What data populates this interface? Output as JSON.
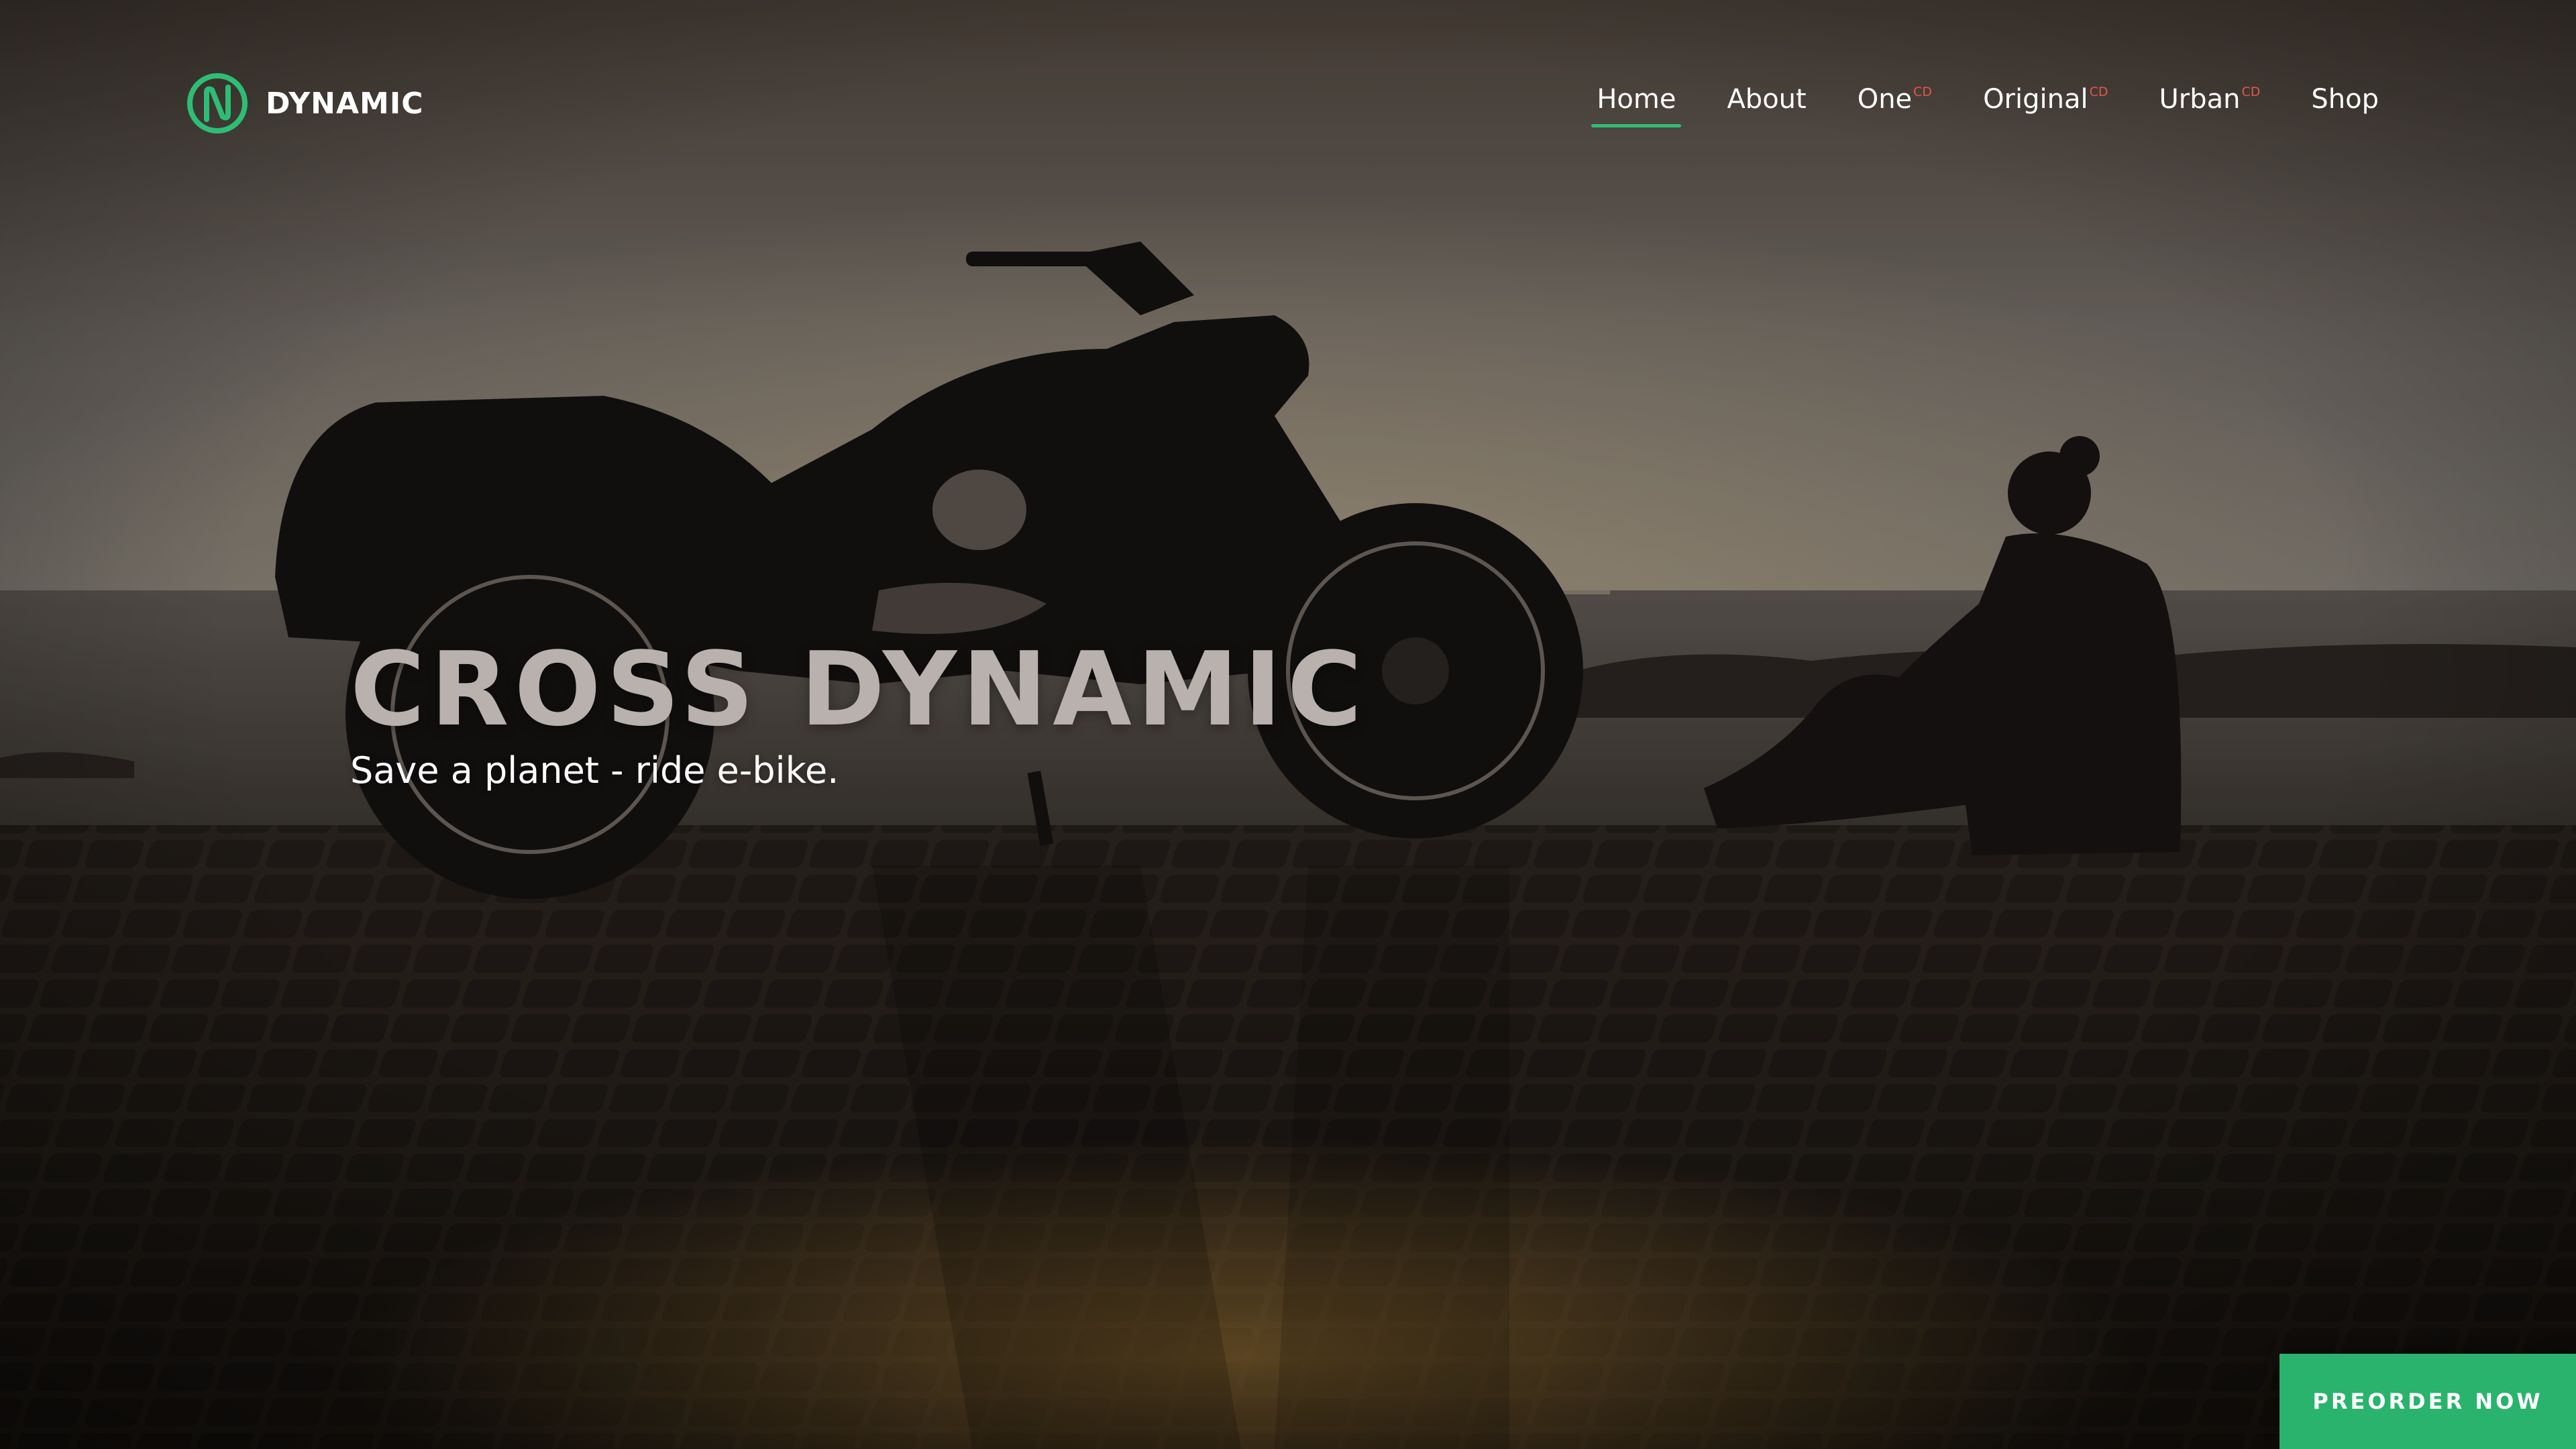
{
  "brand": {
    "name": "DYNAMIC",
    "logo_icon": "dynamic-logo-icon",
    "accent": "#2ebd74"
  },
  "nav": {
    "items": [
      {
        "label": "Home",
        "active": true,
        "badge": ""
      },
      {
        "label": "About",
        "active": false,
        "badge": ""
      },
      {
        "label": "One",
        "active": false,
        "badge": "CD"
      },
      {
        "label": "Original",
        "active": false,
        "badge": "CD"
      },
      {
        "label": "Urban",
        "active": false,
        "badge": "CD"
      },
      {
        "label": "Shop",
        "active": false,
        "badge": ""
      }
    ]
  },
  "hero": {
    "title": "CROSS DYNAMIC",
    "subtitle": "Save a planet - ride e-bike."
  },
  "cta": {
    "label": "PREORDER NOW",
    "color": "#29b36c"
  }
}
